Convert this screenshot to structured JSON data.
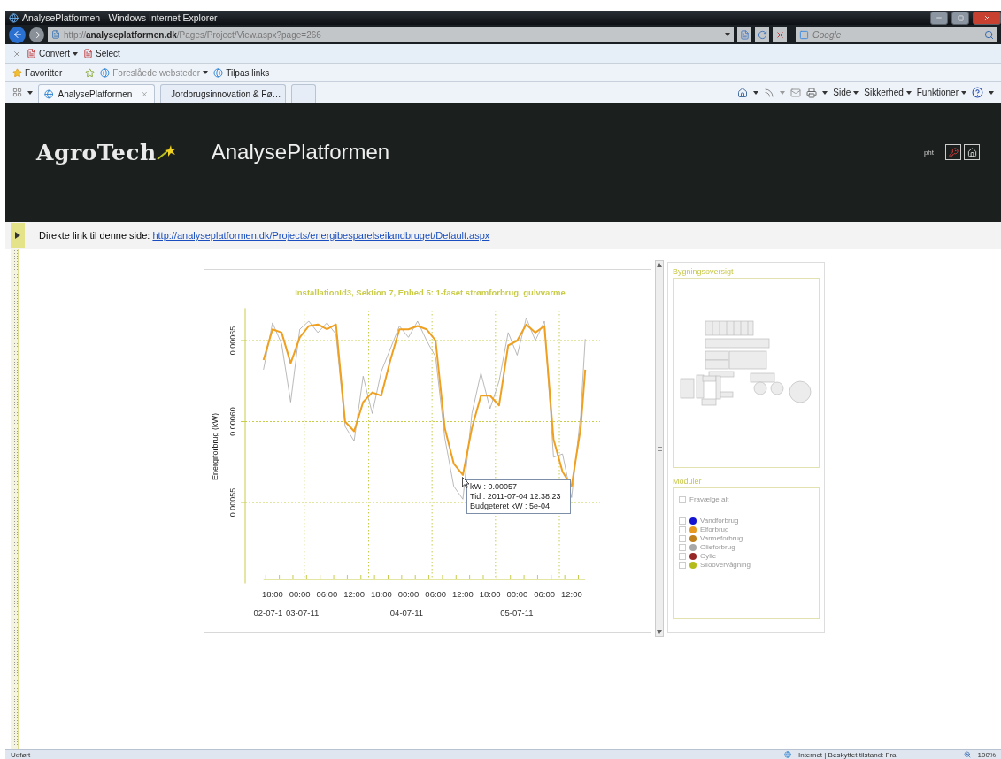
{
  "browser": {
    "title": "AnalysePlatformen - Windows Internet Explorer",
    "address": "http://**analyseplatformen.dk**/Pages/Project/View.aspx?page=266",
    "search": {
      "placeholder": "Google"
    },
    "command_bar": [
      {
        "label": "Convert",
        "kind": "dropdown"
      },
      {
        "label": "Select",
        "kind": "button"
      }
    ],
    "favorites_bar": {
      "favorites": "Favoritter",
      "links": [
        {
          "label": "Foreslåede websteder",
          "kind": "dropdown",
          "disabled": true
        },
        {
          "label": "Tilpas links",
          "kind": "button",
          "disabled": false
        }
      ]
    },
    "tabs": [
      {
        "label": "AnalysePlatformen",
        "selected": true
      },
      {
        "label": "Jordbrugsinnovation & Fø…",
        "selected": false
      }
    ],
    "command_menus": [
      "Side",
      "Sikkerhed",
      "Funktioner"
    ]
  },
  "page": {
    "header": {
      "logo": "AgroTech",
      "title": "AnalysePlatformen",
      "user": "pht"
    },
    "link_bar": {
      "label": "Direkte link til denne side:",
      "url": "http://analyseplatformen.dk/Projects/energibesparelseilandbruget/Default.aspx"
    },
    "chart_panel": {
      "tooltip": {
        "lines": [
          "kW : 0.00057",
          "Tid : 2011-07-04 12:38:23",
          "Budgeteret kW : 5e-04"
        ]
      },
      "date_labels": [
        "02-07-1",
        "03-07-11",
        "04-07-11",
        "05-07-11"
      ],
      "chart_data": {
        "type": "line",
        "title": "InstallationId3, Sektion 7, Enhed 5: 1-faset strømforbrug, gulvvarme",
        "ylabel": "Energiforbrug (kW)",
        "x": [
          "2011-07-02 16:00",
          "2011-07-02 18:00",
          "2011-07-02 20:00",
          "2011-07-02 22:00",
          "2011-07-03 00:00",
          "2011-07-03 02:00",
          "2011-07-03 04:00",
          "2011-07-03 06:00",
          "2011-07-03 08:00",
          "2011-07-03 10:00",
          "2011-07-03 12:00",
          "2011-07-03 14:00",
          "2011-07-03 16:00",
          "2011-07-03 18:00",
          "2011-07-03 20:00",
          "2011-07-03 22:00",
          "2011-07-04 00:00",
          "2011-07-04 02:00",
          "2011-07-04 04:00",
          "2011-07-04 06:00",
          "2011-07-04 08:00",
          "2011-07-04 10:00",
          "2011-07-04 12:00",
          "2011-07-04 14:00",
          "2011-07-04 16:00",
          "2011-07-04 18:00",
          "2011-07-04 20:00",
          "2011-07-04 22:00",
          "2011-07-05 00:00",
          "2011-07-05 02:00",
          "2011-07-05 04:00",
          "2011-07-05 06:00",
          "2011-07-05 08:00",
          "2011-07-05 10:00",
          "2011-07-05 12:00",
          "2011-07-05 14:00",
          "2011-07-05 15:00"
        ],
        "series": [
          {
            "color": "#a8a8a8",
            "values": [
              0.000632,
              0.000661,
              0.000648,
              0.000612,
              0.000657,
              0.000662,
              0.000655,
              0.000661,
              0.000654,
              0.000597,
              0.000588,
              0.000628,
              0.000605,
              0.000631,
              0.000645,
              0.000659,
              0.000652,
              0.000662,
              0.00065,
              0.00064,
              0.00059,
              0.00056,
              0.000552,
              0.000605,
              0.00063,
              0.000608,
              0.000625,
              0.000655,
              0.000641,
              0.000664,
              0.00065,
              0.000662,
              0.000578,
              0.00058,
              0.000553,
              0.000604,
              0.000651
            ]
          },
          {
            "color": "#f0a020",
            "values": [
              0.000638,
              0.000657,
              0.000655,
              0.000636,
              0.000652,
              0.000659,
              0.00066,
              0.000657,
              0.00066,
              0.0006,
              0.000594,
              0.000612,
              0.000618,
              0.000616,
              0.000638,
              0.000657,
              0.000657,
              0.000659,
              0.000657,
              0.00065,
              0.000596,
              0.000574,
              0.000567,
              0.000596,
              0.000616,
              0.000616,
              0.00061,
              0.000647,
              0.00065,
              0.00066,
              0.000655,
              0.000659,
              0.000589,
              0.000569,
              0.00056,
              0.000596,
              0.000632
            ]
          }
        ],
        "xlim": [
          "2011-07-02 16:00",
          "2011-07-05 15:00"
        ],
        "ylim": [
          0.0005,
          0.00067
        ],
        "xticks": [
          {
            "value": "2011-07-02 18:00",
            "label": "18:00"
          },
          {
            "value": "2011-07-03 00:00",
            "label": "00:00"
          },
          {
            "value": "2011-07-03 06:00",
            "label": "06:00"
          },
          {
            "value": "2011-07-03 12:00",
            "label": "12:00"
          },
          {
            "value": "2011-07-03 18:00",
            "label": "18:00"
          },
          {
            "value": "2011-07-04 00:00",
            "label": "00:00"
          },
          {
            "value": "2011-07-04 06:00",
            "label": "06:00"
          },
          {
            "value": "2011-07-04 12:00",
            "label": "12:00"
          },
          {
            "value": "2011-07-04 18:00",
            "label": "18:00"
          },
          {
            "value": "2011-07-05 00:00",
            "label": "00:00"
          },
          {
            "value": "2011-07-05 06:00",
            "label": "06:00"
          },
          {
            "value": "2011-07-05 12:00",
            "label": "12:00"
          }
        ],
        "yticks": [
          {
            "value": 0.00055,
            "label": "0.00055"
          },
          {
            "value": 0.0006,
            "label": "0.00060"
          },
          {
            "value": 0.00065,
            "label": "0.00065"
          }
        ],
        "grid": true
      }
    },
    "building_panel": {
      "title": "Bygningsoversigt"
    },
    "modules_panel": {
      "title": "Moduler",
      "select_all": {
        "label": "Fravælge alt",
        "checked": false
      },
      "modules": [
        {
          "label": "Vandforbrug",
          "checked": false,
          "color": "#1414d2"
        },
        {
          "label": "Elforbrug",
          "checked": false,
          "color": "#e89a20"
        },
        {
          "label": "Varmeforbrug",
          "checked": false,
          "color": "#c0801c"
        },
        {
          "label": "Olieforbrug",
          "checked": false,
          "color": "#a8a8a8"
        },
        {
          "label": "Gylle",
          "checked": false,
          "color": "#982828"
        },
        {
          "label": "Siloovervågning",
          "checked": false,
          "color": "#b4bc1c"
        }
      ]
    }
  },
  "status_bar": {
    "text": "Udført",
    "zone": "Internet | Beskyttet tilstand: Fra",
    "zoom": "100%"
  }
}
